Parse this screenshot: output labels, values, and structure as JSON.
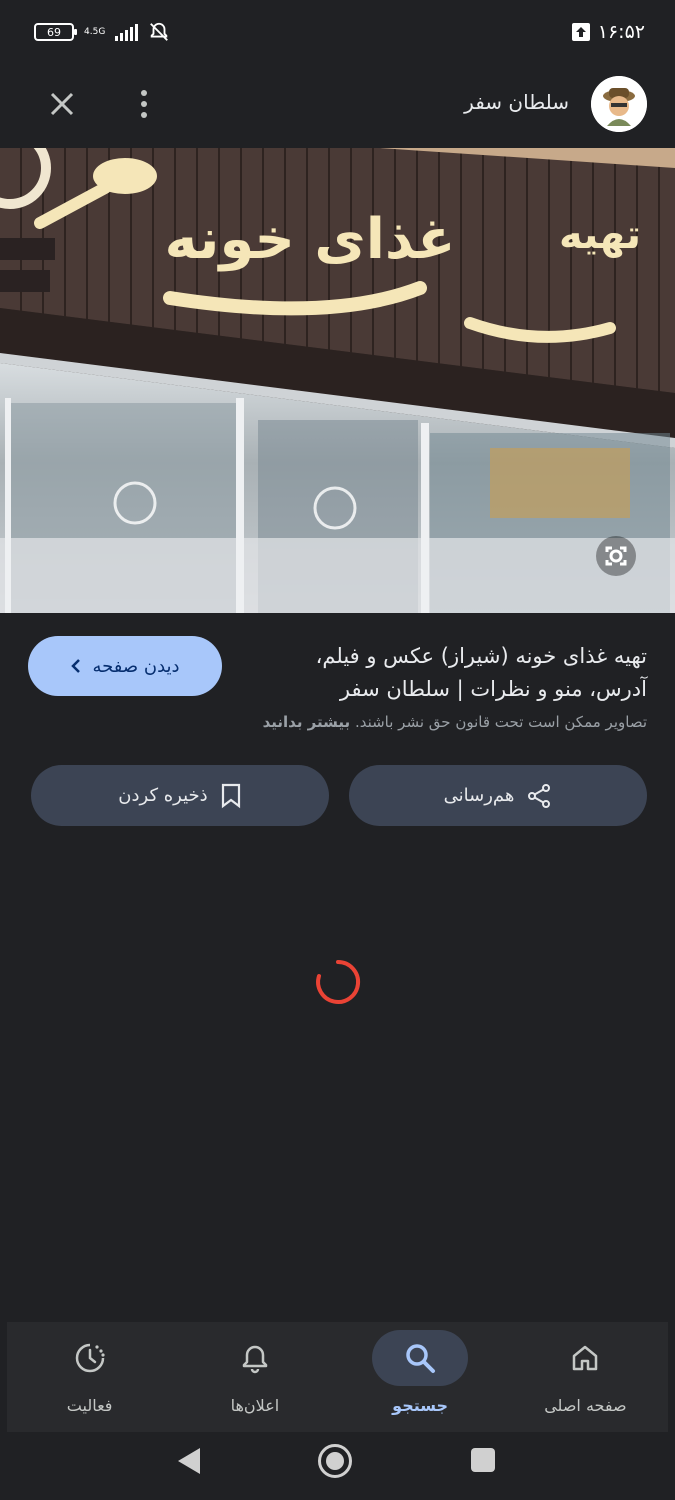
{
  "status_bar": {
    "battery_level": "69",
    "network": "4.5G",
    "time": "۱۶:۵۲"
  },
  "header": {
    "site_name": "سلطان سفر"
  },
  "result": {
    "title": "تهیه غذای خونه (شیراز) عکس و فیلم، آدرس، منو و نظرات | سلطان سفر",
    "view_page_label": "دیدن صفحه",
    "copyright_notice": "تصاویر ممکن است تحت قانون حق نشر باشند.",
    "learn_more": "بیشتر بدانید"
  },
  "actions": {
    "share_label": "هم‌رسانی",
    "save_label": "ذخیره کردن"
  },
  "hero_sign": {
    "line1": "تهیه",
    "line2": "غذای خونه"
  },
  "bottom_nav": {
    "items": [
      {
        "label": "صفحه اصلی",
        "icon": "home-icon",
        "active": false
      },
      {
        "label": "جستجو",
        "icon": "search-icon",
        "active": true
      },
      {
        "label": "اعلان‌ها",
        "icon": "bell-icon",
        "active": false
      },
      {
        "label": "فعالیت",
        "icon": "activity-icon",
        "active": false
      }
    ]
  },
  "colors": {
    "background": "#202124",
    "accent": "#a8c7fa",
    "button_bg": "#3c4454",
    "spinner": "#ea4335"
  }
}
